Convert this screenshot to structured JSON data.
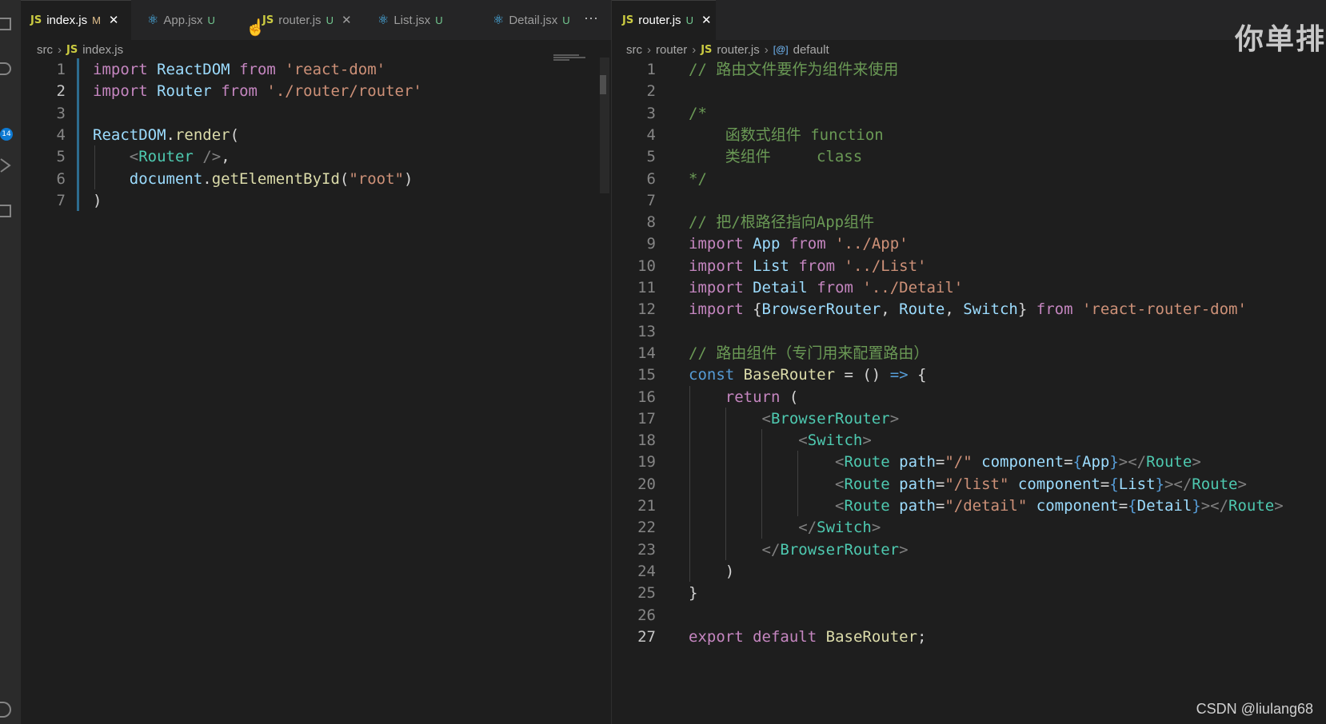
{
  "left_pane": {
    "tabs": [
      {
        "name": "index.js",
        "icon": "JS",
        "status": "M",
        "active": true
      },
      {
        "name": "App.jsx",
        "icon": "react-icon",
        "status": "U",
        "active": false
      },
      {
        "name": "router.js",
        "icon": "JS",
        "status": "U",
        "active": false
      },
      {
        "name": "List.jsx",
        "icon": "react-icon",
        "status": "U",
        "active": false
      },
      {
        "name": "Detail.jsx",
        "icon": "react-icon",
        "status": "U",
        "active": false
      }
    ],
    "more_label": "···",
    "breadcrumb": {
      "folder": "src",
      "file_icon": "JS",
      "file": "index.js"
    },
    "code": [
      [
        [
          "kw",
          "import"
        ],
        [
          "pl",
          " "
        ],
        [
          "var",
          "ReactDOM"
        ],
        [
          "pl",
          " "
        ],
        [
          "kw",
          "from"
        ],
        [
          "pl",
          " "
        ],
        [
          "str",
          "'react-dom'"
        ]
      ],
      [
        [
          "kw",
          "import"
        ],
        [
          "pl",
          " "
        ],
        [
          "var",
          "Router"
        ],
        [
          "pl",
          " "
        ],
        [
          "kw",
          "from"
        ],
        [
          "pl",
          " "
        ],
        [
          "str",
          "'./router/router'"
        ]
      ],
      [],
      [
        [
          "var",
          "ReactDOM"
        ],
        [
          "pl",
          "."
        ],
        [
          "fn",
          "render"
        ],
        [
          "pl",
          "("
        ]
      ],
      [
        [
          "pl",
          "    "
        ],
        [
          "punc",
          "<"
        ],
        [
          "tag",
          "Router"
        ],
        [
          "pl",
          " "
        ],
        [
          "punc",
          "/>"
        ],
        [
          "pl",
          ","
        ]
      ],
      [
        [
          "pl",
          "    "
        ],
        [
          "var",
          "document"
        ],
        [
          "pl",
          "."
        ],
        [
          "fn",
          "getElementById"
        ],
        [
          "pl",
          "("
        ],
        [
          "str",
          "\"root\""
        ],
        [
          "pl",
          ")"
        ]
      ],
      [
        [
          "pl",
          ")"
        ]
      ]
    ],
    "current_line": 2
  },
  "right_pane": {
    "tab": {
      "name": "router.js",
      "icon": "JS",
      "status": "U",
      "active": true
    },
    "breadcrumb": {
      "folder1": "src",
      "folder2": "router",
      "file_icon": "JS",
      "file": "router.js",
      "symbol_icon": "[@]",
      "symbol": "default"
    },
    "code": [
      [
        [
          "cmt",
          "// 路由文件要作为组件来使用"
        ]
      ],
      [],
      [
        [
          "cmt",
          "/*"
        ]
      ],
      [
        [
          "cmt",
          "    函数式组件 function"
        ]
      ],
      [
        [
          "cmt",
          "    类组件     class"
        ]
      ],
      [
        [
          "cmt",
          "*/"
        ]
      ],
      [],
      [
        [
          "cmt",
          "// 把/根路径指向App组件"
        ]
      ],
      [
        [
          "kw",
          "import"
        ],
        [
          "pl",
          " "
        ],
        [
          "var",
          "App"
        ],
        [
          "pl",
          " "
        ],
        [
          "kw",
          "from"
        ],
        [
          "pl",
          " "
        ],
        [
          "str",
          "'../App'"
        ]
      ],
      [
        [
          "kw",
          "import"
        ],
        [
          "pl",
          " "
        ],
        [
          "var",
          "List"
        ],
        [
          "pl",
          " "
        ],
        [
          "kw",
          "from"
        ],
        [
          "pl",
          " "
        ],
        [
          "str",
          "'../List'"
        ]
      ],
      [
        [
          "kw",
          "import"
        ],
        [
          "pl",
          " "
        ],
        [
          "var",
          "Detail"
        ],
        [
          "pl",
          " "
        ],
        [
          "kw",
          "from"
        ],
        [
          "pl",
          " "
        ],
        [
          "str",
          "'../Detail'"
        ]
      ],
      [
        [
          "kw",
          "import"
        ],
        [
          "pl",
          " {"
        ],
        [
          "var",
          "BrowserRouter"
        ],
        [
          "pl",
          ", "
        ],
        [
          "var",
          "Route"
        ],
        [
          "pl",
          ", "
        ],
        [
          "var",
          "Switch"
        ],
        [
          "pl",
          "} "
        ],
        [
          "kw",
          "from"
        ],
        [
          "pl",
          " "
        ],
        [
          "str",
          "'react-router-dom'"
        ]
      ],
      [],
      [
        [
          "cmt",
          "// 路由组件（专门用来配置路由）"
        ]
      ],
      [
        [
          "kw2",
          "const"
        ],
        [
          "pl",
          " "
        ],
        [
          "fn",
          "BaseRouter"
        ],
        [
          "pl",
          " = () "
        ],
        [
          "kw2",
          "=>"
        ],
        [
          "pl",
          " {"
        ]
      ],
      [
        [
          "pl",
          "    "
        ],
        [
          "kw",
          "return"
        ],
        [
          "pl",
          " ("
        ]
      ],
      [
        [
          "pl",
          "        "
        ],
        [
          "punc",
          "<"
        ],
        [
          "tag",
          "BrowserRouter"
        ],
        [
          "punc",
          ">"
        ]
      ],
      [
        [
          "pl",
          "            "
        ],
        [
          "punc",
          "<"
        ],
        [
          "tag",
          "Switch"
        ],
        [
          "punc",
          ">"
        ]
      ],
      [
        [
          "pl",
          "                "
        ],
        [
          "punc",
          "<"
        ],
        [
          "tag",
          "Route"
        ],
        [
          "pl",
          " "
        ],
        [
          "attr",
          "path"
        ],
        [
          "pl",
          "="
        ],
        [
          "str",
          "\"/\""
        ],
        [
          "pl",
          " "
        ],
        [
          "attr",
          "component"
        ],
        [
          "pl",
          "="
        ],
        [
          "kw2",
          "{"
        ],
        [
          "var",
          "App"
        ],
        [
          "kw2",
          "}"
        ],
        [
          "punc",
          "></"
        ],
        [
          "tag",
          "Route"
        ],
        [
          "punc",
          ">"
        ]
      ],
      [
        [
          "pl",
          "                "
        ],
        [
          "punc",
          "<"
        ],
        [
          "tag",
          "Route"
        ],
        [
          "pl",
          " "
        ],
        [
          "attr",
          "path"
        ],
        [
          "pl",
          "="
        ],
        [
          "str",
          "\"/list\""
        ],
        [
          "pl",
          " "
        ],
        [
          "attr",
          "component"
        ],
        [
          "pl",
          "="
        ],
        [
          "kw2",
          "{"
        ],
        [
          "var",
          "List"
        ],
        [
          "kw2",
          "}"
        ],
        [
          "punc",
          "></"
        ],
        [
          "tag",
          "Route"
        ],
        [
          "punc",
          ">"
        ]
      ],
      [
        [
          "pl",
          "                "
        ],
        [
          "punc",
          "<"
        ],
        [
          "tag",
          "Route"
        ],
        [
          "pl",
          " "
        ],
        [
          "attr",
          "path"
        ],
        [
          "pl",
          "="
        ],
        [
          "str",
          "\"/detail\""
        ],
        [
          "pl",
          " "
        ],
        [
          "attr",
          "component"
        ],
        [
          "pl",
          "="
        ],
        [
          "kw2",
          "{"
        ],
        [
          "var",
          "Detail"
        ],
        [
          "kw2",
          "}"
        ],
        [
          "punc",
          "></"
        ],
        [
          "tag",
          "Route"
        ],
        [
          "punc",
          ">"
        ]
      ],
      [
        [
          "pl",
          "            "
        ],
        [
          "punc",
          "</"
        ],
        [
          "tag",
          "Switch"
        ],
        [
          "punc",
          ">"
        ]
      ],
      [
        [
          "pl",
          "        "
        ],
        [
          "punc",
          "</"
        ],
        [
          "tag",
          "BrowserRouter"
        ],
        [
          "punc",
          ">"
        ]
      ],
      [
        [
          "pl",
          "    )"
        ]
      ],
      [
        [
          "pl",
          "}"
        ]
      ],
      [],
      [
        [
          "kw",
          "export"
        ],
        [
          "pl",
          " "
        ],
        [
          "kw",
          "default"
        ],
        [
          "pl",
          " "
        ],
        [
          "fn",
          "BaseRouter"
        ],
        [
          "pl",
          ";"
        ]
      ]
    ],
    "current_line": 27
  },
  "activity_bar": {
    "badge_count": "14",
    "icons": [
      "files-icon",
      "search-icon",
      "source-control-icon",
      "run-debug-icon",
      "extensions-icon",
      "account-icon"
    ]
  },
  "watermark": "你单排",
  "credit": "CSDN @liulang68",
  "colors": {
    "editor_bg": "#1e1e1e",
    "tabbar_bg": "#252526",
    "keyword": "#c586c0",
    "string": "#ce9178",
    "comment": "#6a9955",
    "tag": "#4ec9b0",
    "variable": "#9cdcfe"
  }
}
